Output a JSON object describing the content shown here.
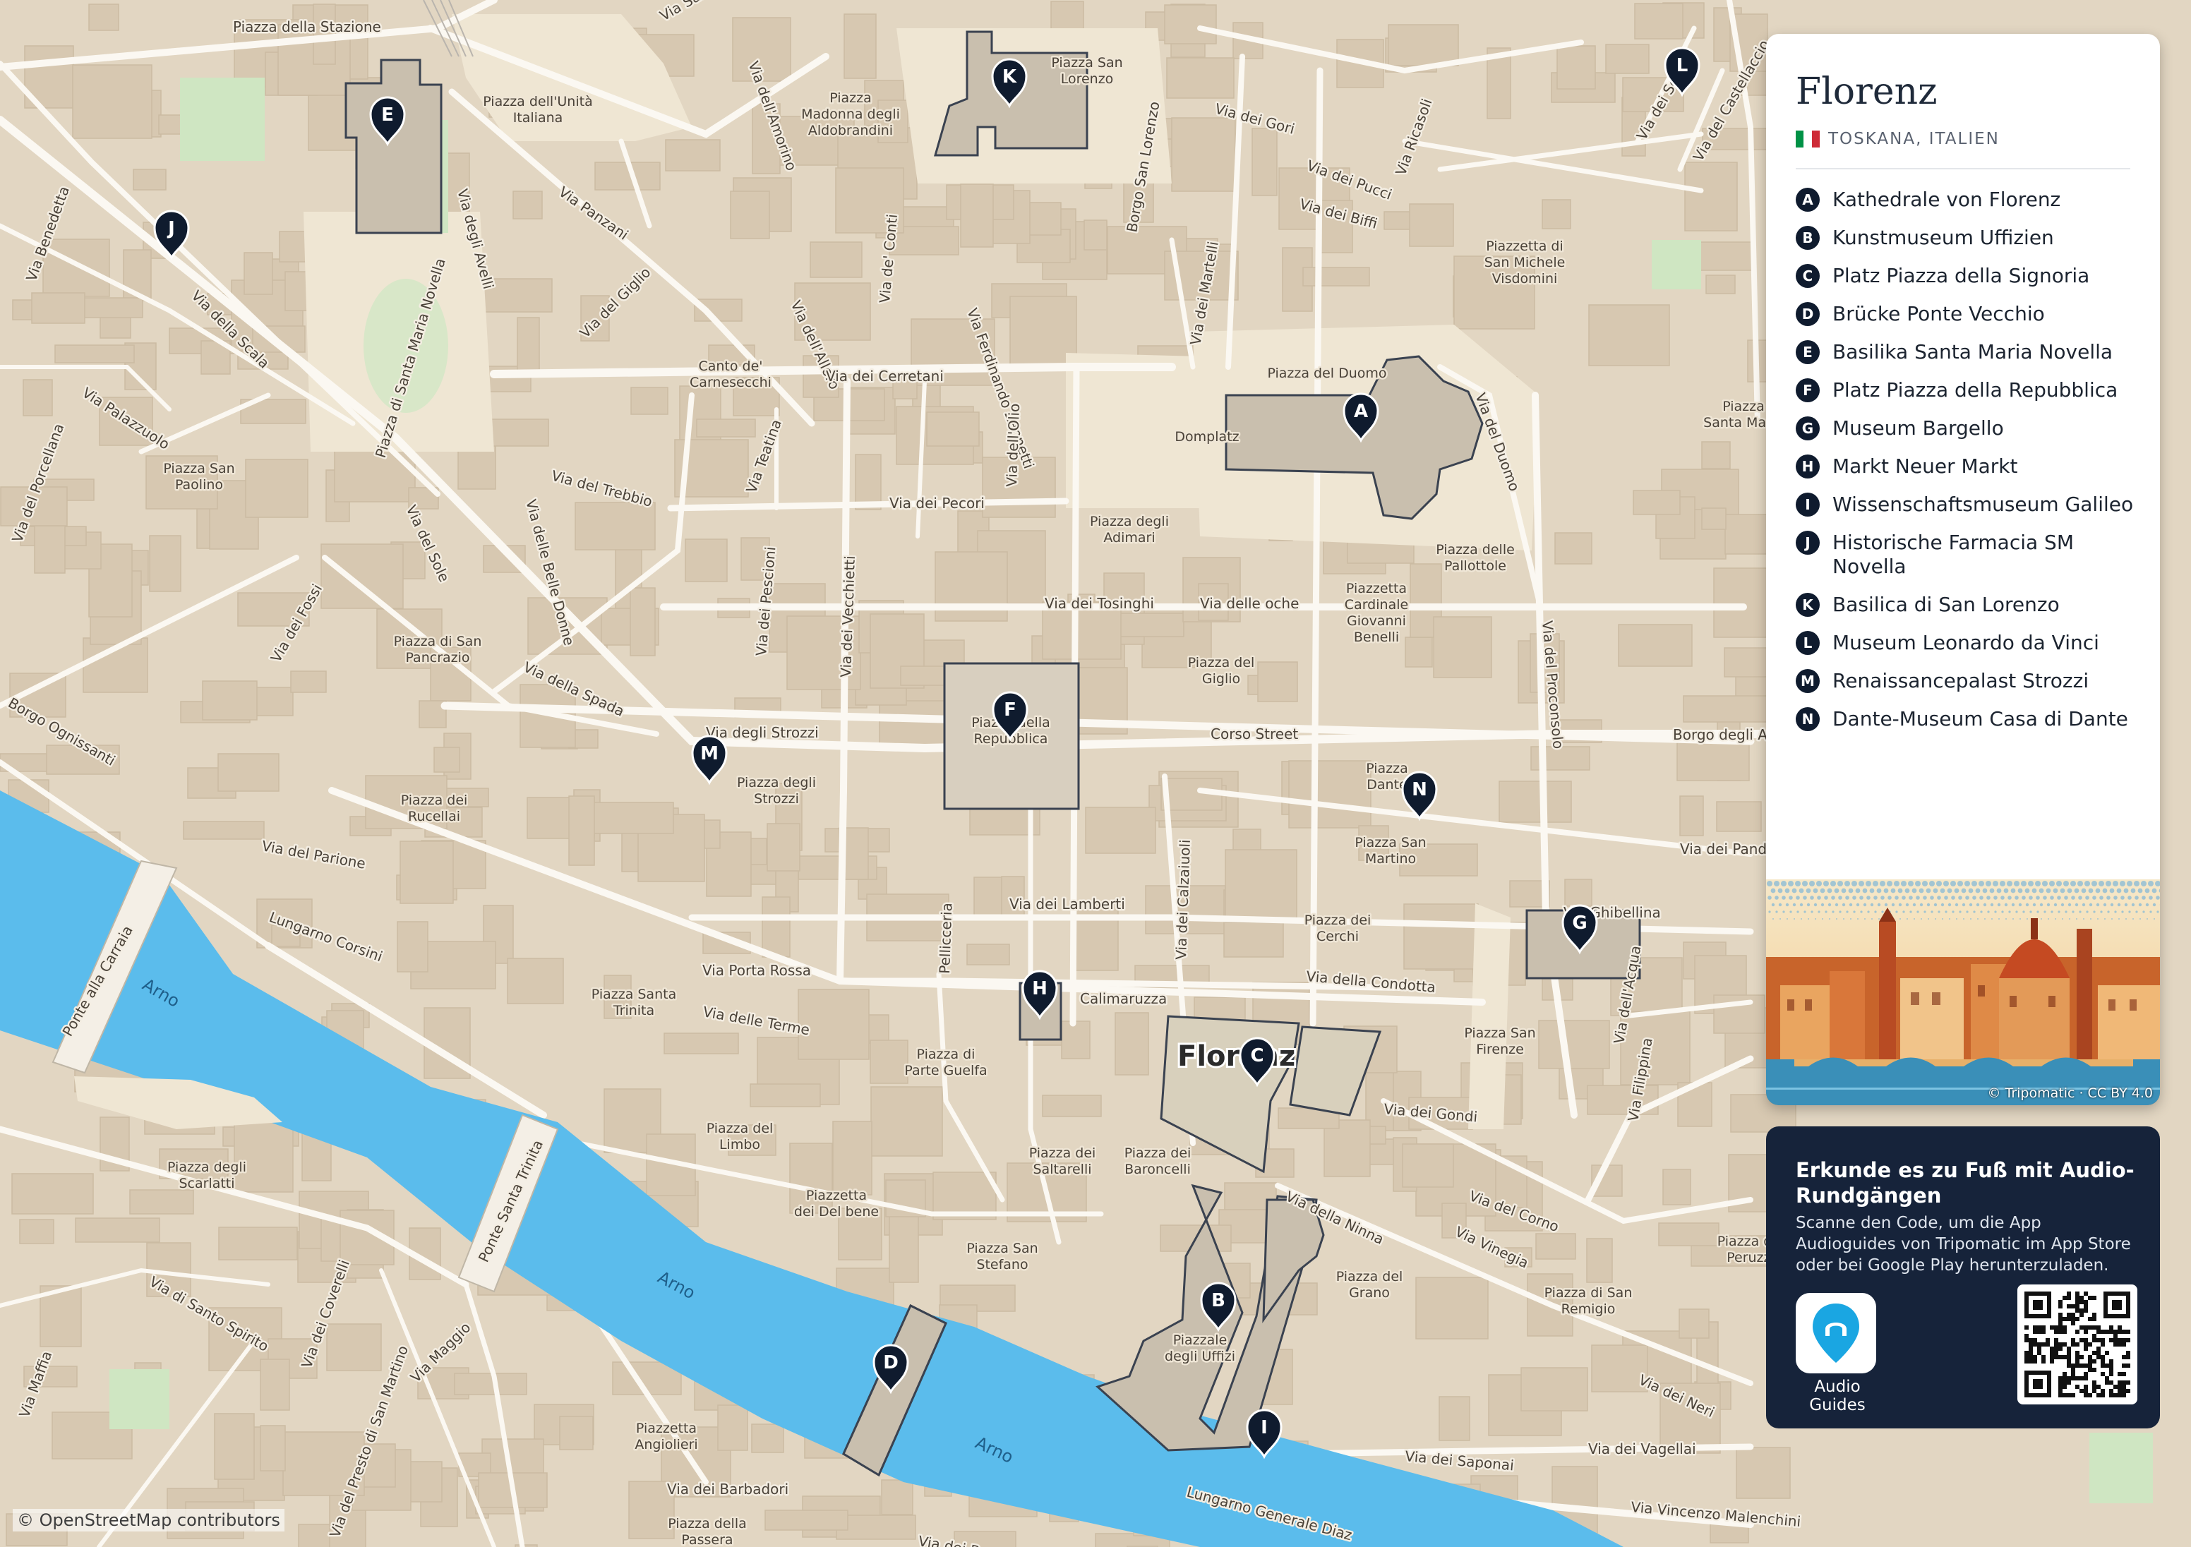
{
  "map": {
    "streets": [
      "Piazza della Stazione",
      "Via Sant'Antonino",
      "Via dell'Amorino",
      "Via degli Avelli",
      "Via Panzani",
      "Via della Scala",
      "Via Palazzuolo",
      "Via Benedetta",
      "Via dell'Alloro",
      "Via de' Conti",
      "Via Ferdinando Zannetti",
      "Borgo San Lorenzo",
      "Via dei Gori",
      "Via dei Pucci",
      "Via dei Biffi",
      "Via dei Servi",
      "Via del Castellaccio",
      "Via Ricasoli",
      "Via dei Martelli",
      "Via del Giglio",
      "Via dei Cerretani",
      "Via del Trebbio",
      "Via Teatina",
      "Via dell'Olio",
      "Via dei Pecori",
      "Via dei Tosinghi",
      "Via delle oche",
      "Via del Proconsolo",
      "Via dei Pescioni",
      "Via dei Vecchietti",
      "Via della Spada",
      "Via degli Strozzi",
      "Corso Street",
      "Borgo degli Albizi",
      "Via del Parione",
      "Lungarno Corsini",
      "Ponte alla Carraia",
      "Via Porta Rossa",
      "Via delle Terme",
      "Via dei Lamberti",
      "Via dei Calzaiuoli",
      "Via della Condotta",
      "Via Ghibellina",
      "Via dell'Acqua",
      "Via dei Gondi",
      "Calimaruzza",
      "Pellicceria",
      "Via della Ninna",
      "Via del Corno",
      "Via Vinegia",
      "Via dei Neri",
      "Ponte Santa Trinita",
      "Via di Santo Spirito",
      "Via dei Coverelli",
      "Via Maggio",
      "Via del Presto di San Martino",
      "Via Maffia",
      "Via dei Barbadori",
      "Via dei Saponai",
      "Via dei Vagellai",
      "Via Vincenzo Malenchini",
      "Lungarno Generale Diaz",
      "Via del Sole",
      "Via delle Belle Donne",
      "Via dei Fossi",
      "Via del Porcellana",
      "Borgo Ognissanti",
      "Piazza di Santa Maria Novella",
      "Via dei Pandolfini",
      "Via Filippina",
      "Via del Duomo",
      "Via dei Bardi"
    ],
    "places": [
      "Piazza dell'Unità Italiana",
      "Piazza Madonna degli Aldobrandini",
      "Piazza San Lorenzo",
      "Canto de' Carnesecchi",
      "Piazza del Duomo",
      "Domplatz",
      "Piazza San Paolino",
      "Piazza degli Adimari",
      "Piazza delle Pallottole",
      "Piazzetta Cardinale Giovanni Benelli",
      "Piazza del Giglio",
      "Piazza di San Pancrazio",
      "Piazza della Repubblica",
      "Piazza degli Strozzi",
      "Piazza dei Rucellai",
      "Piazza San Martino",
      "Piazza Dante",
      "Piazza dei Cerchi",
      "Piazza Santa Trinita",
      "Piazza di Parte Guelfa",
      "Piazza San Firenze",
      "Piazza del Limbo",
      "Piazza dei Saltarelli",
      "Piazza dei Baroncelli",
      "Piazza degli Scarlatti",
      "Piazzetta dei Del bene",
      "Piazza San Stefano",
      "Piazzale degli Uffizi",
      "Piazza del Grano",
      "Piazza dei Peruzzi",
      "Piazza di San Remigio",
      "Piazzetta Angiolieri",
      "Piazza della Passera",
      "Piazzetta di San Michele Visdomini",
      "Piazza Santa Maria"
    ],
    "river": "Arno",
    "city_label": "Florenz",
    "attribution": "© OpenStreetMap contributors",
    "colors": {
      "land": "#e2d6c2",
      "block": "#d7c8b1",
      "road": "#fbf8f2",
      "square": "#efe6d3",
      "water": "#5bbcec",
      "green": "#cfe6c2",
      "poi_fill": "#c9bfae",
      "poi_stroke": "#3a4250",
      "marker": "#0f1b2e"
    },
    "markers": [
      "A",
      "B",
      "C",
      "D",
      "E",
      "F",
      "G",
      "H",
      "I",
      "J",
      "K",
      "L",
      "M",
      "N"
    ]
  },
  "panel": {
    "title": "Florenz",
    "subtitle": "TOSKANA, ITALIEN",
    "flag_colors": [
      "#009246",
      "#ffffff",
      "#ce2b37"
    ],
    "legend": [
      {
        "letter": "A",
        "name": "Kathedrale von Florenz"
      },
      {
        "letter": "B",
        "name": "Kunstmuseum Uffizien"
      },
      {
        "letter": "C",
        "name": "Platz Piazza della Signoria"
      },
      {
        "letter": "D",
        "name": "Brücke Ponte Vecchio"
      },
      {
        "letter": "E",
        "name": "Basilika Santa Maria Novella"
      },
      {
        "letter": "F",
        "name": "Platz Piazza della Repubblica"
      },
      {
        "letter": "G",
        "name": "Museum Bargello"
      },
      {
        "letter": "H",
        "name": "Markt Neuer Markt"
      },
      {
        "letter": "I",
        "name": "Wissenschaftsmuseum Galileo"
      },
      {
        "letter": "J",
        "name": "Historische Farmacia SM Novella"
      },
      {
        "letter": "K",
        "name": "Basilica di San Lorenzo"
      },
      {
        "letter": "L",
        "name": "Museum Leonardo da Vinci"
      },
      {
        "letter": "M",
        "name": "Renaissancepalast Strozzi"
      },
      {
        "letter": "N",
        "name": "Dante-Museum Casa di Dante"
      }
    ],
    "illustration_credit": "© Tripomatic · CC BY 4.0"
  },
  "promo": {
    "title": "Erkunde es zu Fuß mit Audio-Rundgängen",
    "description": "Scanne den Code, um die App Audioguides von Tripomatic im App Store oder bei Google Play herunterzuladen.",
    "app_label": "Audio Guides"
  }
}
